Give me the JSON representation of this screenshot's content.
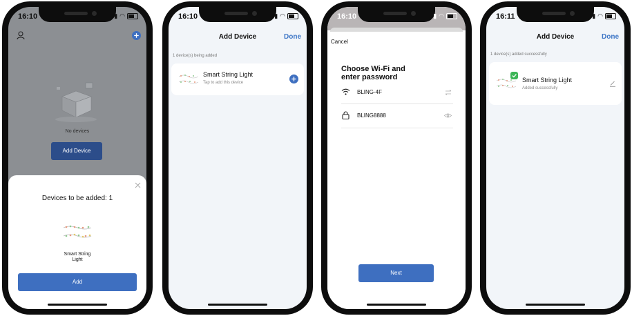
{
  "status": {
    "time1": "16:10",
    "time2": "16:10",
    "time3": "16:10",
    "time4": "16:11"
  },
  "screen1": {
    "empty_text": "No devices",
    "add_device_button": "Add Device",
    "sheet_title": "Devices to be added: 1",
    "device_name": "Smart String\nLight",
    "add_button": "Add"
  },
  "screen2": {
    "title": "Add Device",
    "done": "Done",
    "section": "1 device(s) being added",
    "device_name": "Smart String Light",
    "device_hint": "Tap to add this device"
  },
  "screen3": {
    "cancel": "Cancel",
    "heading": "Choose Wi-Fi and\nenter password",
    "wifi_name": "BLING-4F",
    "password": "BLING8888",
    "next": "Next"
  },
  "screen4": {
    "title": "Add Device",
    "done": "Done",
    "section": "1 device(s) added successfully",
    "device_name": "Smart String Light",
    "device_status": "Added successfully"
  },
  "colors": {
    "accent": "#3e6fc0",
    "success": "#3cb557",
    "background": "#f2f5f9"
  }
}
